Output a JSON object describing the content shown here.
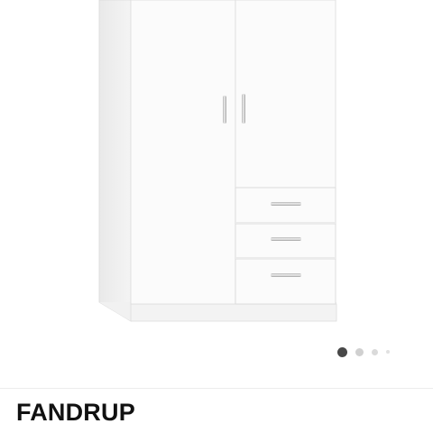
{
  "product": {
    "name": "FANDRUP",
    "image_icon": "wardrobe-image"
  },
  "carousel": {
    "active_index": 1,
    "dot_count": 4,
    "colors": {
      "active": "#484848",
      "inactive": "#d0d0d0"
    }
  }
}
